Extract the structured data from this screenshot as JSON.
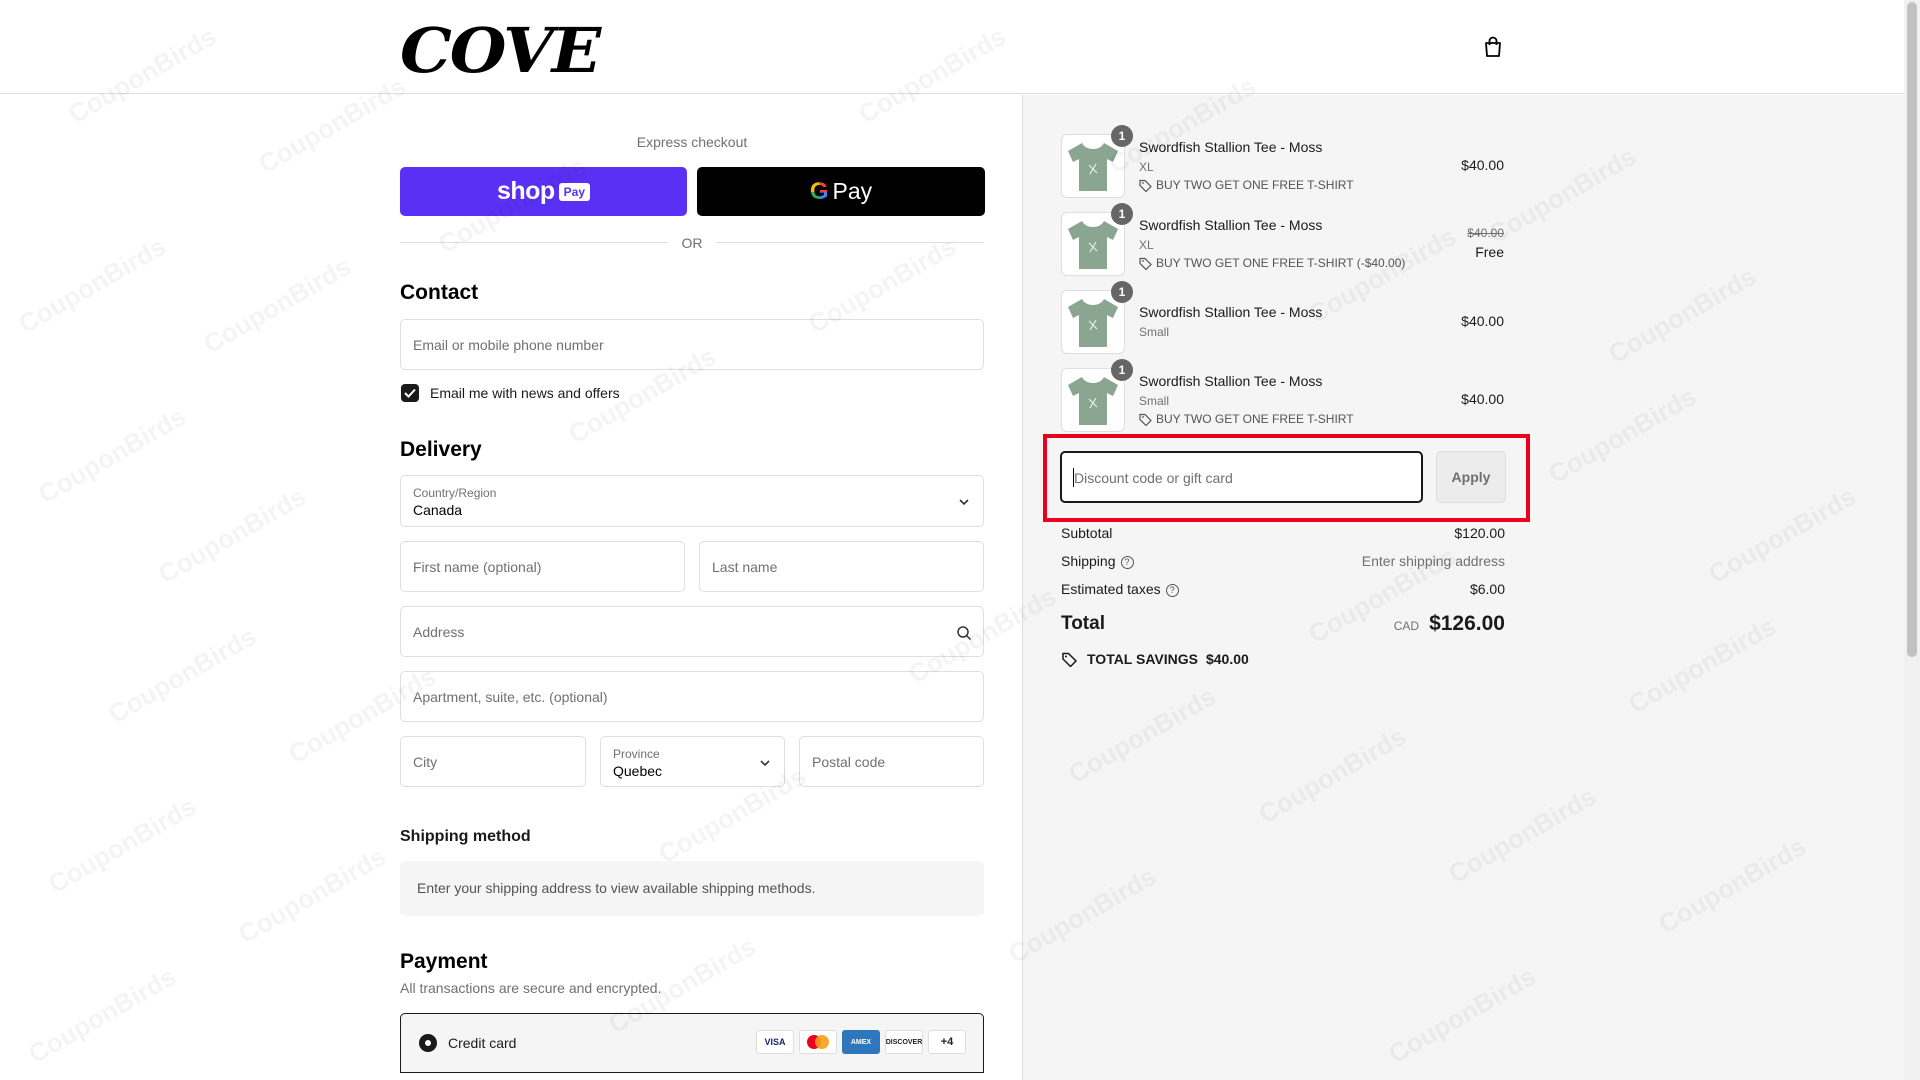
{
  "brand": {
    "logo_text": "COVE"
  },
  "header": {
    "cart_icon": "shopping-bag-icon"
  },
  "express": {
    "label": "Express checkout",
    "shop_pay": {
      "shop": "shop",
      "pay": "Pay"
    },
    "google_pay": {
      "g": "G",
      "pay": "Pay"
    },
    "or": "OR"
  },
  "contact": {
    "title": "Contact",
    "email_placeholder": "Email or mobile phone number",
    "newsletter_label": "Email me with news and offers",
    "newsletter_checked": true
  },
  "delivery": {
    "title": "Delivery",
    "country_label": "Country/Region",
    "country_value": "Canada",
    "first_name_placeholder": "First name (optional)",
    "last_name_placeholder": "Last name",
    "address_placeholder": "Address",
    "apartment_placeholder": "Apartment, suite, etc. (optional)",
    "city_placeholder": "City",
    "province_label": "Province",
    "province_value": "Quebec",
    "postal_placeholder": "Postal code"
  },
  "shipping_method": {
    "title": "Shipping method",
    "message": "Enter your shipping address to view available shipping methods."
  },
  "payment": {
    "title": "Payment",
    "subtitle": "All transactions are secure and encrypted.",
    "credit_card_label": "Credit card",
    "cards": [
      "VISA",
      "MC",
      "AMEX",
      "DISCOVER",
      "+4"
    ]
  },
  "order": {
    "items": [
      {
        "qty": "1",
        "title": "Swordfish Stallion Tee - Moss",
        "variant": "XL",
        "discount": "BUY TWO GET ONE FREE T-SHIRT",
        "price": "$40.00",
        "original_price": ""
      },
      {
        "qty": "1",
        "title": "Swordfish Stallion Tee - Moss",
        "variant": "XL",
        "discount": "BUY TWO GET ONE FREE T-SHIRT (-$40.00)",
        "price": "Free",
        "original_price": "$40.00"
      },
      {
        "qty": "1",
        "title": "Swordfish Stallion Tee - Moss",
        "variant": "Small",
        "discount": "",
        "price": "$40.00",
        "original_price": ""
      },
      {
        "qty": "1",
        "title": "Swordfish Stallion Tee - Moss",
        "variant": "Small",
        "discount": "BUY TWO GET ONE FREE T-SHIRT",
        "price": "$40.00",
        "original_price": ""
      }
    ],
    "discount_placeholder": "Discount code or gift card",
    "apply_label": "Apply",
    "subtotal_label": "Subtotal",
    "subtotal_value": "$120.00",
    "shipping_label": "Shipping",
    "shipping_value": "Enter shipping address",
    "taxes_label": "Estimated taxes",
    "taxes_value": "$6.00",
    "total_label": "Total",
    "total_currency": "CAD",
    "total_value": "$126.00",
    "savings_label": "TOTAL SAVINGS",
    "savings_value": "$40.00"
  },
  "watermark": "CouponBirds",
  "colors": {
    "shop_pay": "#5a31f4",
    "highlight": "#e8001c",
    "tee": "#8aa690"
  }
}
